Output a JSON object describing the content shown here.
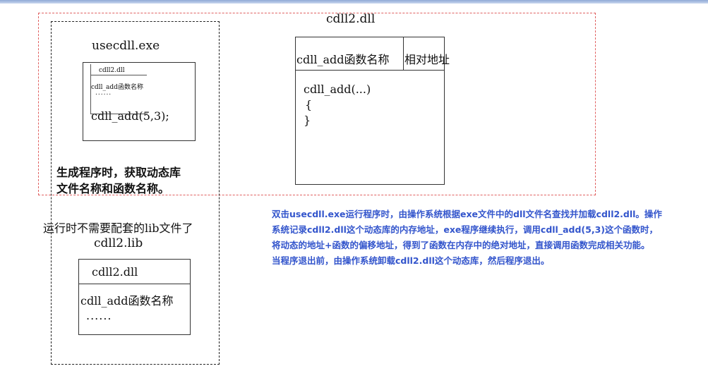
{
  "dll_box": {
    "title": "cdll2.dll",
    "table_col1": "cdll_add函数名称",
    "table_col2": "相对地址",
    "code_line1": "cdll_add(...)",
    "code_line2": "{",
    "code_line3": "}"
  },
  "exe_box": {
    "title": "usecdll.exe",
    "inner_title": "cdll2.dll",
    "inner_item": "cdll_add函数名称",
    "inner_dots": "......",
    "call": "cdll_add(5,3);",
    "note_line1": "生成程序时，获取动态库",
    "note_line2": "文件名称和函数名称。"
  },
  "runtime_note": "运行时不需要配套的lib文件了",
  "lib_box": {
    "title": "cdll2.lib",
    "inner_title": "cdll2.dll",
    "inner_item": "cdll_add函数名称",
    "inner_dots": "......"
  },
  "explanation": {
    "line1": "双击usecdll.exe运行程序时，由操作系统根据exe文件中的dll文件名查找并加载cdll2.dll。操作",
    "line2": "系统记录cdll2.dll这个动态库的内存地址，exe程序继续执行，调用cdll_add(5,3)这个函数时，",
    "line3": "将动态的地址+函数的偏移地址，得到了函数在内存中的绝对地址，直接调用函数完成相关功能。",
    "line4": "当程序退出前，由操作系统卸载cdll2.dll这个动态库，然后程序退出。"
  },
  "colors": {
    "red_dash": "#e06060",
    "note_blue": "#3355cc"
  }
}
